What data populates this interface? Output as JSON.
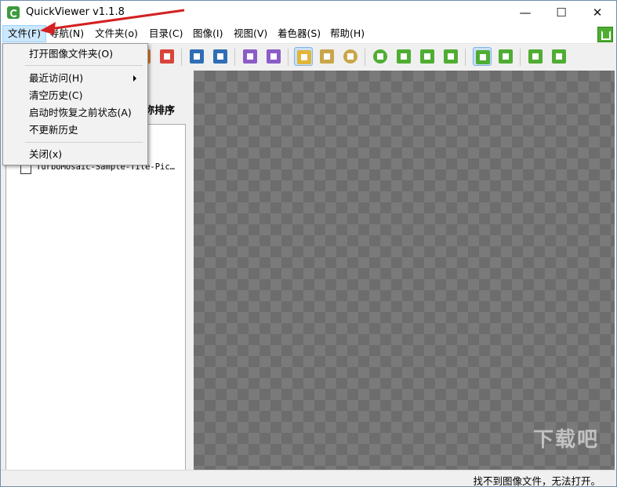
{
  "window": {
    "title": "QuickViewer v1.1.8",
    "min": "—",
    "max": "☐",
    "close": "✕"
  },
  "menubar": {
    "items": [
      "文件(F)",
      "导航(N)",
      "文件夹(o)",
      "目录(C)",
      "图像(I)",
      "视图(V)",
      "着色器(S)",
      "帮助(H)"
    ]
  },
  "file_menu": {
    "items": [
      "打开图像文件夹(O)",
      "最近访问(H)",
      "清空历史(C)",
      "启动时恢复之前状态(A)",
      "不更新历史",
      "关闭(x)"
    ]
  },
  "left_pane": {
    "sort_label": "称排序",
    "file_name": "TurboMosaic-Sample-Tile-Pic…"
  },
  "status": {
    "text": "找不到图像文件，无法打开。"
  },
  "watermark": "下载吧",
  "colors": {
    "accent_green": "#4fad33",
    "highlight": "#cce8ff",
    "arrow": "#d42020"
  }
}
